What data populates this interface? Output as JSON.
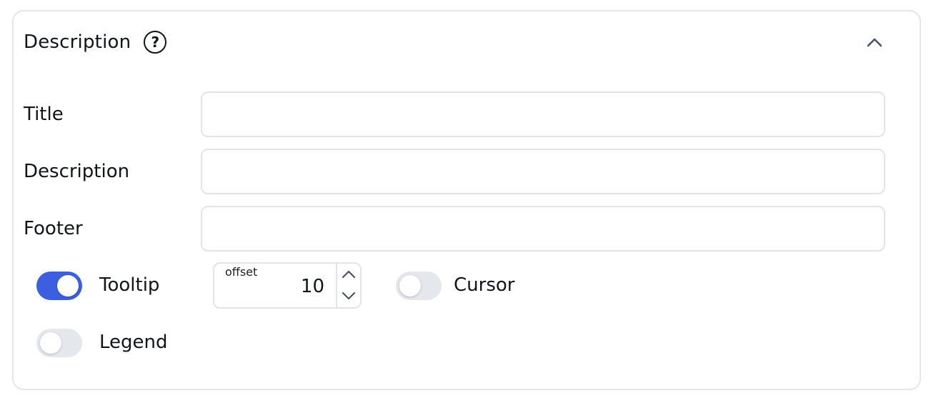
{
  "section": {
    "title": "Description",
    "help_icon": "question-circle-icon",
    "collapse_icon": "chevron-up-icon"
  },
  "fields": {
    "title": {
      "label": "Title",
      "value": "",
      "placeholder": ""
    },
    "description": {
      "label": "Description",
      "value": "",
      "placeholder": ""
    },
    "footer": {
      "label": "Footer",
      "value": "",
      "placeholder": ""
    }
  },
  "tooltip": {
    "label": "Tooltip",
    "enabled": true,
    "offset_label": "offset",
    "offset_value": "10"
  },
  "cursor": {
    "label": "Cursor",
    "enabled": false
  },
  "legend": {
    "label": "Legend",
    "enabled": false
  },
  "colors": {
    "accent": "#3b5fe0",
    "toggle_off": "#e4e7ec",
    "border": "#e2e4e8"
  }
}
